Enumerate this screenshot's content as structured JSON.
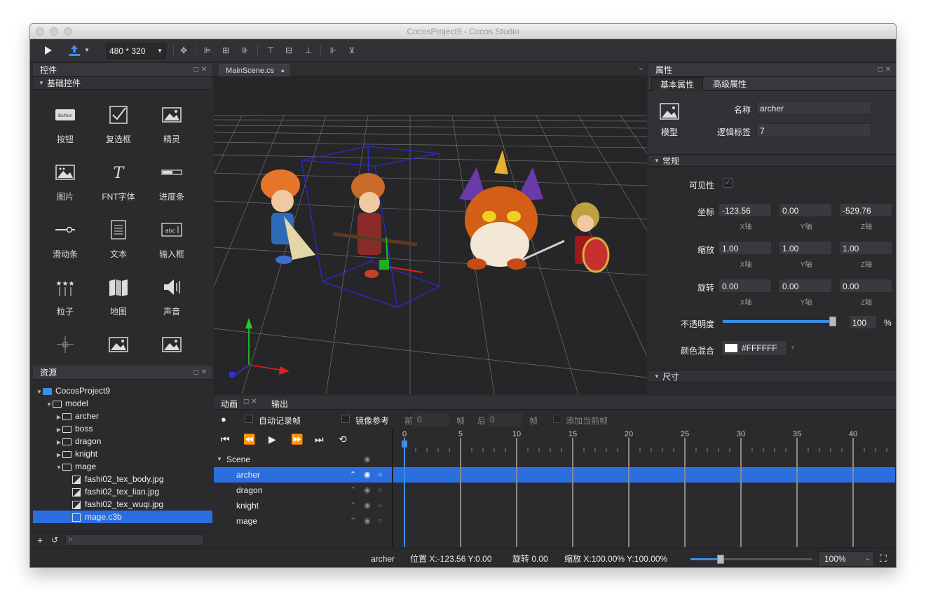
{
  "window": {
    "title": "CocosProject9 - Cocos Studio"
  },
  "toolbar": {
    "resolution": "480 * 320"
  },
  "widgets_panel": {
    "title": "控件",
    "section": "基础控件",
    "items": [
      {
        "label": "按钮",
        "icon": "button-widget-icon"
      },
      {
        "label": "复选框",
        "icon": "checkbox-widget-icon"
      },
      {
        "label": "精灵",
        "icon": "sprite-widget-icon"
      },
      {
        "label": "图片",
        "icon": "image-widget-icon"
      },
      {
        "label": "FNT字体",
        "icon": "fnt-font-widget-icon"
      },
      {
        "label": "进度条",
        "icon": "progress-bar-widget-icon"
      },
      {
        "label": "滑动条",
        "icon": "slider-widget-icon"
      },
      {
        "label": "文本",
        "icon": "text-widget-icon"
      },
      {
        "label": "输入框",
        "icon": "input-box-widget-icon"
      },
      {
        "label": "粒子",
        "icon": "particle-widget-icon"
      },
      {
        "label": "地图",
        "icon": "map-widget-icon"
      },
      {
        "label": "声音",
        "icon": "sound-widget-icon"
      }
    ],
    "button_icon_text": "Button",
    "textfield_icon_text": "abc"
  },
  "resources_panel": {
    "title": "资源",
    "tree": [
      {
        "label": "CocosProject9",
        "depth": 0,
        "kind": "project",
        "expanded": true
      },
      {
        "label": "model",
        "depth": 1,
        "kind": "folder",
        "expanded": true
      },
      {
        "label": "archer",
        "depth": 2,
        "kind": "folder",
        "expanded": false
      },
      {
        "label": "boss",
        "depth": 2,
        "kind": "folder",
        "expanded": false
      },
      {
        "label": "dragon",
        "depth": 2,
        "kind": "folder",
        "expanded": false
      },
      {
        "label": "knight",
        "depth": 2,
        "kind": "folder",
        "expanded": false
      },
      {
        "label": "mage",
        "depth": 2,
        "kind": "folder",
        "expanded": true
      },
      {
        "label": "fashi02_tex_body.jpg",
        "depth": 3,
        "kind": "image"
      },
      {
        "label": "fashi02_tex_lian.jpg",
        "depth": 3,
        "kind": "image"
      },
      {
        "label": "fashi02_tex_wuqi.jpg",
        "depth": 3,
        "kind": "image"
      },
      {
        "label": "mage.c3b",
        "depth": 3,
        "kind": "file",
        "selected": true
      }
    ]
  },
  "editor": {
    "tab": "MainScene.cs"
  },
  "properties": {
    "title": "属性",
    "tabs": [
      "基本属性",
      "高级属性"
    ],
    "model_label": "模型",
    "name_label": "名称",
    "name_value": "archer",
    "tag_label": "逻辑标签",
    "tag_value": "7",
    "general_section": "常规",
    "visible_label": "可见性",
    "position_label": "坐标",
    "position": [
      "-123.56",
      "0.00",
      "-529.76"
    ],
    "scale_label": "缩放",
    "scale": [
      "1.00",
      "1.00",
      "1.00"
    ],
    "rotation_label": "旋转",
    "rotation": [
      "0.00",
      "0.00",
      "0.00"
    ],
    "axis_labels": [
      "X轴",
      "Y轴",
      "Z轴"
    ],
    "opacity_label": "不透明度",
    "opacity_value": "100",
    "opacity_unit": "%",
    "opacity_fraction": 1.0,
    "blend_label": "颜色混合",
    "blend_value": "#FFFFFF",
    "size_section": "尺寸"
  },
  "animation": {
    "tabs": [
      "动画",
      "输出"
    ],
    "auto_record_label": "自动记录帧",
    "onion_label": "镜像参考",
    "before_label": "前",
    "before_value": "0",
    "frame_unit": "帧",
    "after_label": "后",
    "after_value": "0",
    "add_frame_label": "添加当前帧",
    "tracks": [
      "Scene",
      "archer",
      "dragon",
      "knight",
      "mage"
    ],
    "ruler": [
      "0",
      "5",
      "10",
      "15",
      "20",
      "25",
      "30",
      "35",
      "40"
    ]
  },
  "status": {
    "object": "archer",
    "position": "位置 X:-123.56   Y:0.00",
    "rotation": "旋转 0.00",
    "scale": "缩放 X:100.00%   Y:100.00%",
    "zoom": "100%"
  },
  "colors": {
    "accent": "#2b6ee0",
    "panel": "#2e2e31",
    "viewport": "#262628"
  }
}
